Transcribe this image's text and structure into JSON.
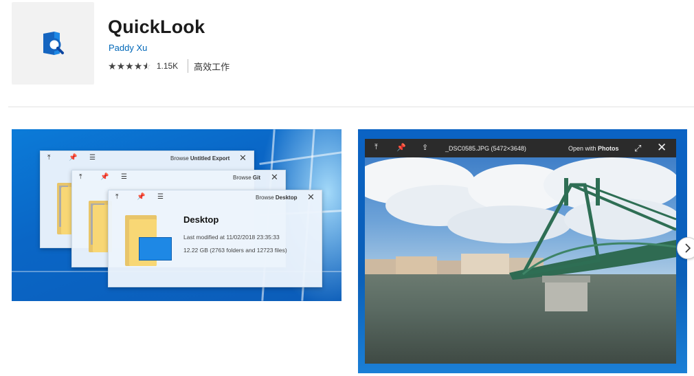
{
  "app": {
    "title": "QuickLook",
    "publisher": "Paddy Xu",
    "rating": 4.5,
    "rating_max": 5,
    "rating_count": "1.15K",
    "category": "高效工作",
    "icon": "quicklook-app-icon"
  },
  "screenshots": [
    {
      "name": "screenshot-1",
      "windows": [
        {
          "title_prefix": "Browse ",
          "title_bold": "Untitled Export"
        },
        {
          "title_prefix": "Browse ",
          "title_bold": "Git"
        },
        {
          "title_prefix": "Browse ",
          "title_bold": "Desktop"
        }
      ],
      "folder_name": "Desktop",
      "last_modified": "Last modified at 11/02/2018 23:35:33",
      "size_info": "12.22 GB (2763 folders and 12723 files)"
    },
    {
      "name": "screenshot-2",
      "file_name": "_DSC0585.JPG (5472×3648)",
      "open_with_prefix": "Open with ",
      "open_with_app": "Photos"
    }
  ],
  "icons": {
    "pin_top": "pin-top-icon",
    "pin": "pushpin-icon",
    "menu": "list-menu-icon",
    "share": "share-icon",
    "fullscreen": "fullscreen-icon",
    "close": "close-icon",
    "next": "chevron-right-icon"
  },
  "colors": {
    "accent": "#0067b8",
    "windows_blue": "#0a66c6"
  }
}
